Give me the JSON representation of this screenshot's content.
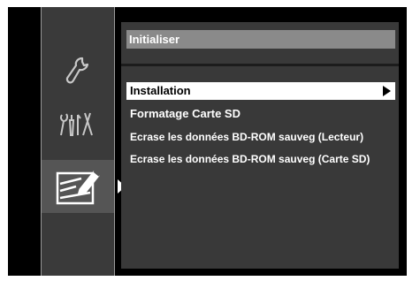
{
  "icons": {
    "tools": "wrench-icon",
    "settings": "tools-icon",
    "edit": "edit-pencil-icon"
  },
  "panel": {
    "title": "Initialiser",
    "items": [
      {
        "label": "Installation",
        "selected": true,
        "has_submenu": true
      },
      {
        "label": "Formatage Carte SD",
        "selected": false
      },
      {
        "label": "Ecrase les données BD-ROM sauveg (Lecteur)",
        "selected": false
      },
      {
        "label": "Ecrase les données BD-ROM sauveg (Carte SD)",
        "selected": false
      }
    ]
  },
  "colors": {
    "background": "#000000",
    "sidebar": "#3a3a3a",
    "panel": "#393939",
    "title_bar": "#8a8a8a",
    "highlight": "#ffffff"
  }
}
